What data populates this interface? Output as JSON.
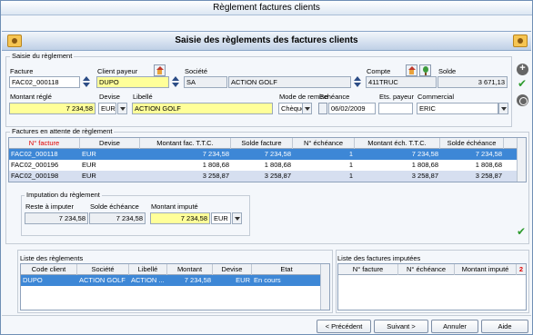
{
  "window": {
    "title": "Règlement factures clients"
  },
  "header": {
    "title": "Saisie des règlements des factures clients"
  },
  "reglement": {
    "group_label": "Saisie du règlement",
    "facture": {
      "label": "Facture",
      "value": "FAC02_000118"
    },
    "client_payeur": {
      "label": "Client payeur",
      "value": "DUPO"
    },
    "societe": {
      "label": "Société",
      "code": "SA",
      "name": "ACTION GOLF"
    },
    "compte": {
      "label": "Compte",
      "value": "411TRUC"
    },
    "solde": {
      "label": "Solde",
      "value": "3 671,13"
    },
    "montant_regle": {
      "label": "Montant réglé",
      "value": "7 234,58"
    },
    "devise": {
      "label": "Devise",
      "value": "EUR"
    },
    "libelle": {
      "label": "Libellé",
      "value": "ACTION GOLF"
    },
    "mode_remise": {
      "label": "Mode de remise",
      "value": "Chèque"
    },
    "echeance": {
      "label": "Echéance",
      "value": "06/02/2009"
    },
    "ets_payeur": {
      "label": "Ets. payeur",
      "value": ""
    },
    "commercial": {
      "label": "Commercial",
      "value": "ERIC"
    }
  },
  "factures": {
    "group_label": "Factures en attente de règlement",
    "columns": [
      "N° facture",
      "Devise",
      "Montant fac. T.T.C.",
      "Solde facture",
      "N° échéance",
      "Montant éch. T.T.C.",
      "Solde échéance"
    ],
    "rows": [
      [
        "FAC02_000118",
        "EUR",
        "7 234,58",
        "7 234,58",
        "1",
        "7 234,58",
        "7 234,58"
      ],
      [
        "FAC02_000196",
        "EUR",
        "1 808,68",
        "1 808,68",
        "1",
        "1 808,68",
        "1 808,68"
      ],
      [
        "FAC02_000198",
        "EUR",
        "3 258,87",
        "3 258,87",
        "1",
        "3 258,87",
        "3 258,87"
      ]
    ]
  },
  "imputation": {
    "group_label": "Imputation du règlement",
    "reste": {
      "label": "Reste à imputer",
      "value": "7 234,58"
    },
    "solde_echeance": {
      "label": "Solde échéance",
      "value": "7 234,58"
    },
    "montant_impute": {
      "label": "Montant imputé",
      "value": "7 234,58"
    },
    "devise": "EUR"
  },
  "reglements_list": {
    "title": "Liste des règlements",
    "columns": [
      "Code client",
      "Société",
      "Libellé",
      "Montant",
      "Devise",
      "Etat"
    ],
    "rows": [
      [
        "DUPO",
        "ACTION GOLF",
        "ACTION ...",
        "7 234,58",
        "EUR",
        "En cours"
      ]
    ]
  },
  "imputees_list": {
    "title": "Liste des factures imputées",
    "columns": [
      "N° facture",
      "N° échéance",
      "Montant imputé"
    ],
    "sort_marker": "2"
  },
  "buttons": {
    "precedent": "< Précédent",
    "suivant": "Suivant >",
    "annuler": "Annuler",
    "aide": "Aide"
  },
  "colors": {
    "accent": "#3d87d6",
    "highlight": "#ffff99",
    "alt_row": "#d6dff0"
  }
}
